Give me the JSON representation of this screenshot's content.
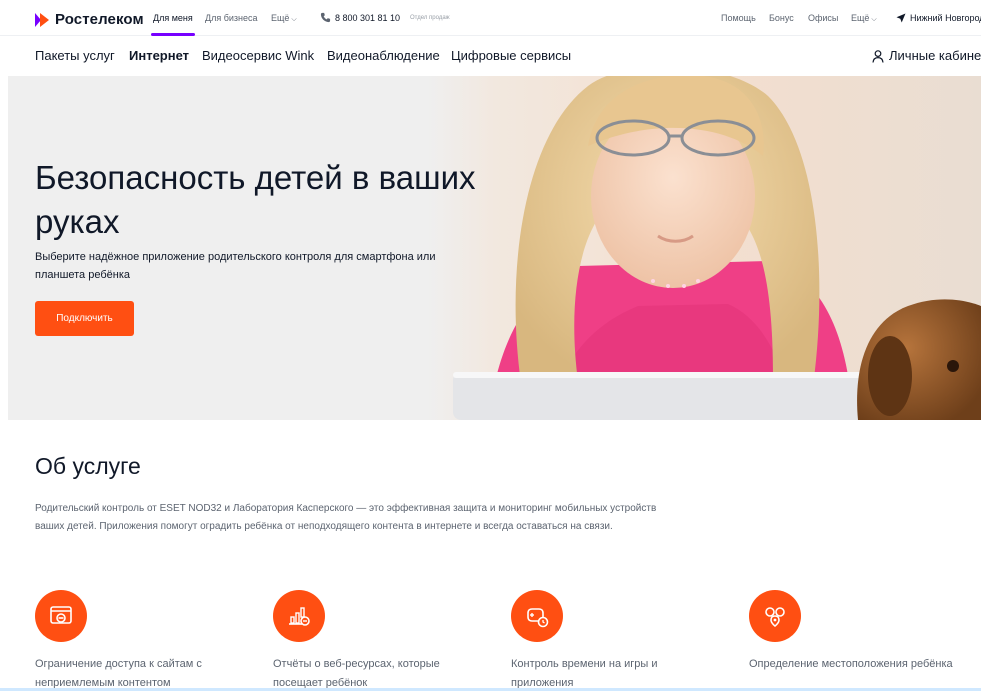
{
  "brand": {
    "name": "Ростелеком"
  },
  "topbar": {
    "segments": [
      {
        "label": "Для меня"
      },
      {
        "label": "Для бизнеса"
      },
      {
        "label": "Ещё"
      }
    ],
    "phone": "8 800 301 81 10",
    "phone_caption": "Отдел продаж",
    "right_links": [
      {
        "label": "Помощь"
      },
      {
        "label": "Бонус"
      },
      {
        "label": "Офисы"
      },
      {
        "label": "Ещё"
      }
    ],
    "city": "Нижний Новгород"
  },
  "nav": {
    "items": [
      {
        "label": "Пакеты услуг"
      },
      {
        "label": "Интернет"
      },
      {
        "label": "Видеосервис Wink"
      },
      {
        "label": "Видеонаблюдение"
      },
      {
        "label": "Цифровые сервисы"
      }
    ],
    "cabinet": "Личные кабинеты"
  },
  "hero": {
    "title": "Безопасность детей в ваших руках",
    "subtitle": "Выберите надёжное приложение родительского контроля для смартфона или планшета ребёнка",
    "button": "Подключить"
  },
  "about": {
    "title": "Об услуге",
    "text": "Родительский контроль от ESET NOD32 и Лаборатория Касперского — это эффективная защита и мониторинг мобильных устройств ваших детей. Приложения помогут оградить ребёнка от неподходящего контента в интернете и всегда оставаться на связи.",
    "features": [
      {
        "icon": "browser-block-icon",
        "label": "Ограничение доступа к сайтам с неприемлемым контентом"
      },
      {
        "icon": "report-chart-icon",
        "label": "Отчёты о веб-ресурсах, которые посещает ребёнок"
      },
      {
        "icon": "gamepad-clock-icon",
        "label": "Контроль времени на игры и приложения"
      },
      {
        "icon": "location-icon",
        "label": "Определение местоположения ребёнка"
      }
    ]
  },
  "colors": {
    "accent": "#ff4f12",
    "brand_purple": "#7700ff",
    "text": "#101828",
    "muted": "#5c6470"
  }
}
